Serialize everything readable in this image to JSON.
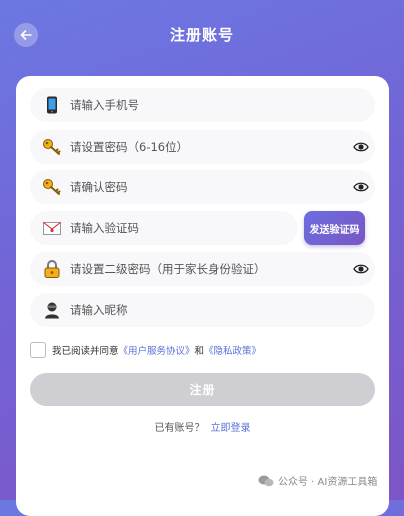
{
  "header": {
    "title": "注册账号",
    "back_icon": "arrow-left-icon"
  },
  "form": {
    "phone": {
      "placeholder": "请输入手机号",
      "icon": "phone-icon"
    },
    "password": {
      "placeholder": "请设置密码（6-16位）",
      "icon": "key-icon"
    },
    "confirm_password": {
      "placeholder": "请确认密码",
      "icon": "key-icon"
    },
    "verify_code": {
      "placeholder": "请输入验证码",
      "icon": "envelope-icon",
      "send_button": "发送验证码"
    },
    "secondary_password": {
      "placeholder": "请设置二级密码（用于家长身份验证）",
      "icon": "lock-icon"
    },
    "nickname": {
      "placeholder": "请输入昵称",
      "icon": "user-icon"
    }
  },
  "agreement": {
    "prefix": "我已阅读并同意",
    "terms": "《用户服务协议》",
    "and": "和",
    "privacy": "《隐私政策》"
  },
  "submit_label": "注册",
  "login": {
    "prompt": "已有账号？",
    "link": "立即登录"
  },
  "watermark": "公众号 · AI资源工具箱",
  "colors": {
    "gradient_start": "#6c78e2",
    "gradient_end": "#7d55c6",
    "link": "#5b6fd8",
    "submit_disabled": "#cfcfd3"
  }
}
